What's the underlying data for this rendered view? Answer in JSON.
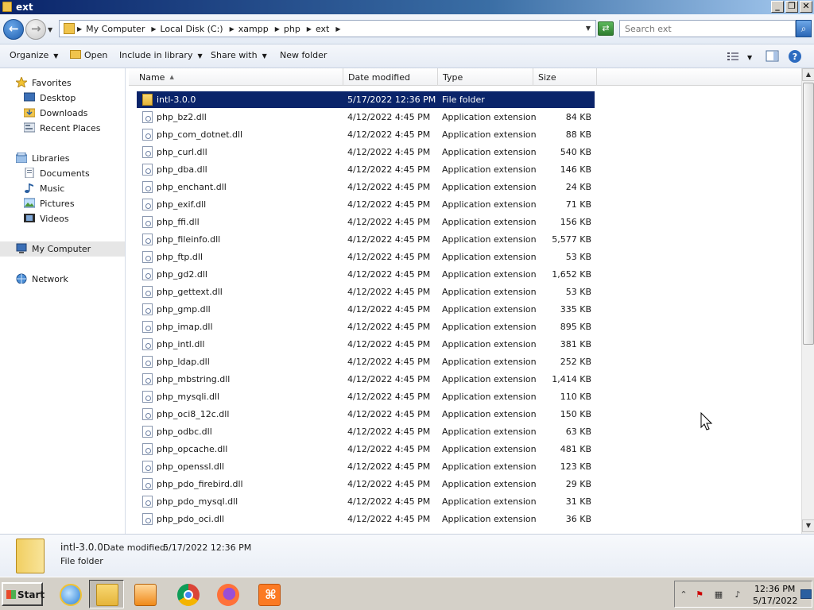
{
  "window": {
    "title": "ext"
  },
  "titlebar_buttons": {
    "minimize": "_",
    "restore": "❐",
    "close": "✕"
  },
  "address": {
    "crumbs": [
      "My Computer",
      "Local Disk (C:)",
      "xampp",
      "php",
      "ext"
    ],
    "search_placeholder": "Search ext"
  },
  "toolbar": {
    "organize": "Organize",
    "open": "Open",
    "include_in_library": "Include in library",
    "share_with": "Share with",
    "new_folder": "New folder"
  },
  "nav": {
    "favorites": "Favorites",
    "desktop": "Desktop",
    "downloads": "Downloads",
    "recent_places": "Recent Places",
    "libraries": "Libraries",
    "documents": "Documents",
    "music": "Music",
    "pictures": "Pictures",
    "videos": "Videos",
    "my_computer": "My Computer",
    "network": "Network"
  },
  "columns": {
    "name": "Name",
    "date_modified": "Date modified",
    "type": "Type",
    "size": "Size"
  },
  "files": [
    {
      "name": "intl-3.0.0",
      "date": "5/17/2022 12:36 PM",
      "type": "File folder",
      "size": "",
      "folder": true,
      "selected": true
    },
    {
      "name": "php_bz2.dll",
      "date": "4/12/2022 4:45 PM",
      "type": "Application extension",
      "size": "84 KB"
    },
    {
      "name": "php_com_dotnet.dll",
      "date": "4/12/2022 4:45 PM",
      "type": "Application extension",
      "size": "88 KB"
    },
    {
      "name": "php_curl.dll",
      "date": "4/12/2022 4:45 PM",
      "type": "Application extension",
      "size": "540 KB"
    },
    {
      "name": "php_dba.dll",
      "date": "4/12/2022 4:45 PM",
      "type": "Application extension",
      "size": "146 KB"
    },
    {
      "name": "php_enchant.dll",
      "date": "4/12/2022 4:45 PM",
      "type": "Application extension",
      "size": "24 KB"
    },
    {
      "name": "php_exif.dll",
      "date": "4/12/2022 4:45 PM",
      "type": "Application extension",
      "size": "71 KB"
    },
    {
      "name": "php_ffi.dll",
      "date": "4/12/2022 4:45 PM",
      "type": "Application extension",
      "size": "156 KB"
    },
    {
      "name": "php_fileinfo.dll",
      "date": "4/12/2022 4:45 PM",
      "type": "Application extension",
      "size": "5,577 KB"
    },
    {
      "name": "php_ftp.dll",
      "date": "4/12/2022 4:45 PM",
      "type": "Application extension",
      "size": "53 KB"
    },
    {
      "name": "php_gd2.dll",
      "date": "4/12/2022 4:45 PM",
      "type": "Application extension",
      "size": "1,652 KB"
    },
    {
      "name": "php_gettext.dll",
      "date": "4/12/2022 4:45 PM",
      "type": "Application extension",
      "size": "53 KB"
    },
    {
      "name": "php_gmp.dll",
      "date": "4/12/2022 4:45 PM",
      "type": "Application extension",
      "size": "335 KB"
    },
    {
      "name": "php_imap.dll",
      "date": "4/12/2022 4:45 PM",
      "type": "Application extension",
      "size": "895 KB"
    },
    {
      "name": "php_intl.dll",
      "date": "4/12/2022 4:45 PM",
      "type": "Application extension",
      "size": "381 KB"
    },
    {
      "name": "php_ldap.dll",
      "date": "4/12/2022 4:45 PM",
      "type": "Application extension",
      "size": "252 KB"
    },
    {
      "name": "php_mbstring.dll",
      "date": "4/12/2022 4:45 PM",
      "type": "Application extension",
      "size": "1,414 KB"
    },
    {
      "name": "php_mysqli.dll",
      "date": "4/12/2022 4:45 PM",
      "type": "Application extension",
      "size": "110 KB"
    },
    {
      "name": "php_oci8_12c.dll",
      "date": "4/12/2022 4:45 PM",
      "type": "Application extension",
      "size": "150 KB"
    },
    {
      "name": "php_odbc.dll",
      "date": "4/12/2022 4:45 PM",
      "type": "Application extension",
      "size": "63 KB"
    },
    {
      "name": "php_opcache.dll",
      "date": "4/12/2022 4:45 PM",
      "type": "Application extension",
      "size": "481 KB"
    },
    {
      "name": "php_openssl.dll",
      "date": "4/12/2022 4:45 PM",
      "type": "Application extension",
      "size": "123 KB"
    },
    {
      "name": "php_pdo_firebird.dll",
      "date": "4/12/2022 4:45 PM",
      "type": "Application extension",
      "size": "29 KB"
    },
    {
      "name": "php_pdo_mysql.dll",
      "date": "4/12/2022 4:45 PM",
      "type": "Application extension",
      "size": "31 KB"
    },
    {
      "name": "php_pdo_oci.dll",
      "date": "4/12/2022 4:45 PM",
      "type": "Application extension",
      "size": "36 KB"
    }
  ],
  "details": {
    "name": "intl-3.0.0",
    "date_label": "Date modified:",
    "date_value": "5/17/2022 12:36 PM",
    "type": "File folder"
  },
  "taskbar": {
    "start": "Start",
    "apps": [
      "internet-explorer-icon",
      "windows-explorer-icon",
      "media-player-icon",
      "chrome-icon",
      "firefox-icon",
      "xampp-icon"
    ],
    "clock_time": "12:36 PM",
    "clock_date": "5/17/2022"
  },
  "colors": {
    "selection": "#0a246a",
    "titlebar": "#0a246a"
  }
}
